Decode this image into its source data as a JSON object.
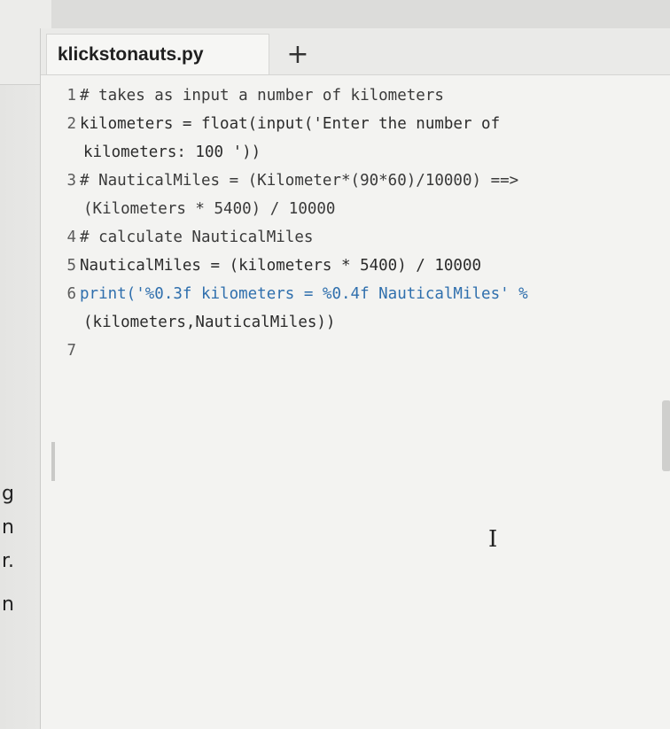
{
  "tabs": [
    {
      "label": "klickstonauts.py",
      "active": true
    }
  ],
  "new_tab_label": "+",
  "left_fragments": [
    "g",
    "n",
    "r.",
    "n"
  ],
  "code": {
    "line_numbers": [
      "1",
      "2",
      "3",
      "4",
      "5",
      "6",
      "7"
    ],
    "lines": [
      "# takes as input a number of kilometers",
      "kilometers = float(input('Enter the number of",
      "kilometers: 100 '))",
      "# NauticalMiles = (Kilometer*(90*60)/10000) ==>",
      "(Kilometers * 5400) / 10000",
      "# calculate NauticalMiles",
      "NauticalMiles = (kilometers * 5400) / 10000",
      "print('%0.3f kilometers = %0.4f NauticalMiles' %",
      "(kilometers,NauticalMiles))",
      ""
    ]
  },
  "colors": {
    "comment": "#3a3a3a",
    "keyword": "#2f6fad",
    "string": "#2a7a2a",
    "number": "#c86a1a"
  },
  "icons": {
    "cursor": "i-beam-icon"
  }
}
